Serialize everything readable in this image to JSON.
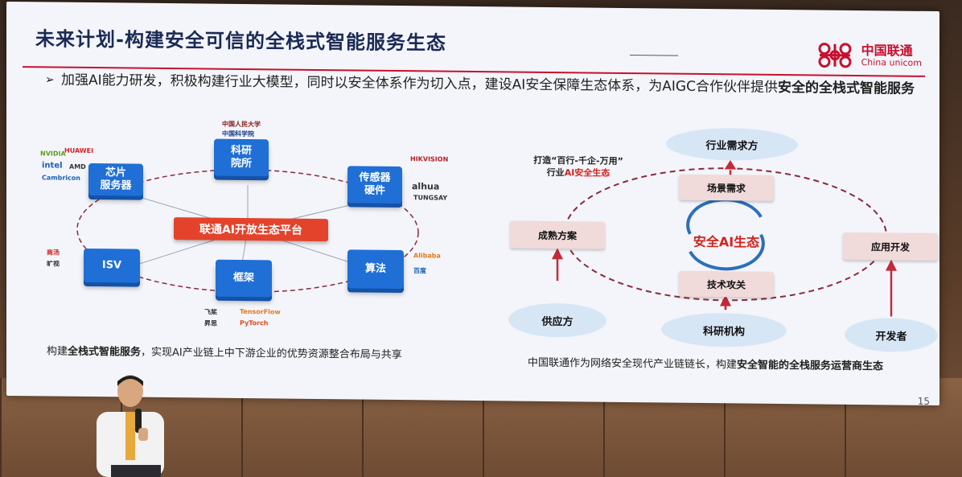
{
  "slide": {
    "title": "未来计划-构建安全可信的全栈式智能服务生态",
    "logo": {
      "cn": "中国联通",
      "en": "China unicom"
    },
    "intro_part1": "加强AI能力研发，积极构建行业大模型，同时以安全体系作为切入点，建设AI安全保障生态体系，为AIGC合作伙伴提供",
    "intro_bold": "安全的全栈式智能服务",
    "bullet": "➢",
    "page_number": "15"
  },
  "left_diagram": {
    "platform": "联通AI开放生态平台",
    "nodes": [
      {
        "label": "科研\n院所"
      },
      {
        "label": "芯片\n服务器"
      },
      {
        "label": "传感器\n硬件"
      },
      {
        "label": "ISV"
      },
      {
        "label": "框架"
      },
      {
        "label": "算法"
      }
    ],
    "brands": {
      "research": [
        "中国人民大学",
        "中国科学院"
      ],
      "chip": [
        "NVIDIA",
        "HUAWEI",
        "intel",
        "AMD",
        "Cambricon"
      ],
      "sensor": [
        "HIKVISION",
        "alhua",
        "TUNGSAY"
      ],
      "isv": [
        "商汤",
        "旷视"
      ],
      "framework": [
        "飞桨",
        "TensorFlow",
        "昇思",
        "PyTorch"
      ],
      "algorithm": [
        "Alibaba",
        "百度"
      ]
    },
    "caption_pre": "构建",
    "caption_bold": "全栈式智能服务",
    "caption_post": "，实现AI产业链上中下游企业的优势资源整合布局与共享"
  },
  "right_diagram": {
    "slogan_line1": "打造“百行-千企-万用”",
    "slogan_line2a": "行业",
    "slogan_line2b": "AI安全生态",
    "center": "安全AI生态",
    "top_pill": "行业需求方",
    "top_box": "场景需求",
    "left_box": "成熟方案",
    "right_box": "应用开发",
    "bottom_box": "技术攻关",
    "pill_supplier": "供应方",
    "pill_research": "科研机构",
    "pill_developer": "开发者",
    "caption_pre": "中国联通作为网络安全现代产业链链长，构建",
    "caption_bold": "安全智能的全栈服务运营商生态"
  },
  "colors": {
    "brand_red": "#c8102e",
    "node_blue": "#1f6fd6",
    "platform_red": "#e4432b",
    "pill_blue": "#d7e6f5",
    "box_pink": "#f1dada"
  }
}
